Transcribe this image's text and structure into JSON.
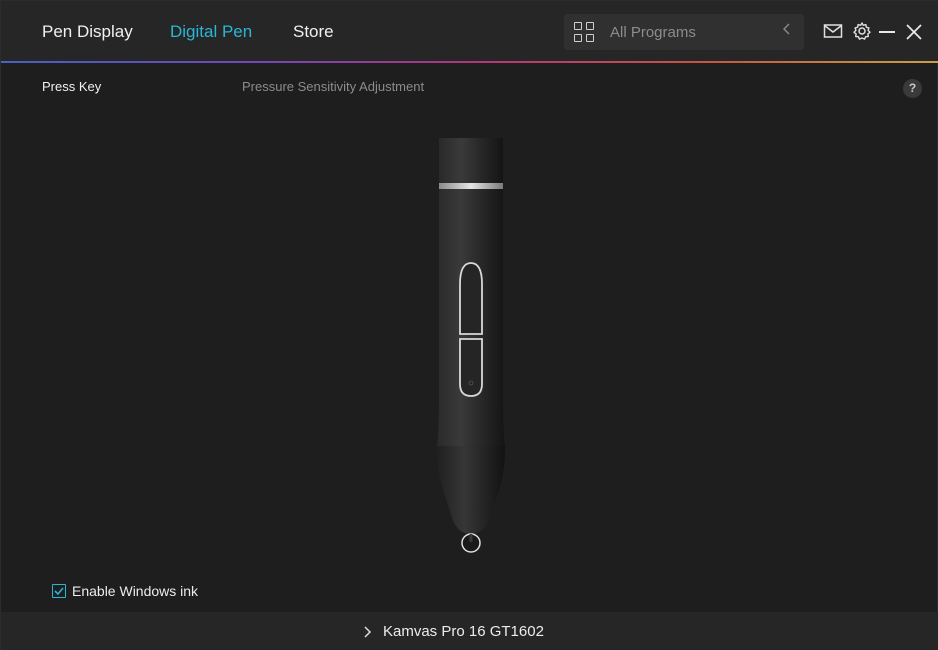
{
  "header": {
    "tabs": [
      {
        "label": "Pen Display",
        "active": false
      },
      {
        "label": "Digital Pen",
        "active": true
      },
      {
        "label": "Store",
        "active": false
      }
    ],
    "programs_label": "All Programs",
    "icons": [
      "grid-icon",
      "chevron-left-icon",
      "mail-icon",
      "gear-icon",
      "minimize-icon",
      "close-icon"
    ]
  },
  "subtabs": {
    "press_key": "Press Key",
    "pressure": "Pressure Sensitivity Adjustment",
    "help": "?"
  },
  "settings": {
    "enable_windows_ink_label": "Enable Windows ink",
    "enable_windows_ink_checked": true
  },
  "footer": {
    "device_name": "Kamvas Pro 16 GT1602"
  },
  "colors": {
    "accent": "#2bb5d6",
    "background": "#1e1e1e",
    "header": "#262626"
  }
}
